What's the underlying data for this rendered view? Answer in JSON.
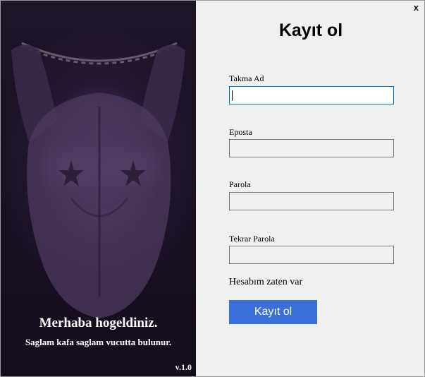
{
  "hero": {
    "greeting": "Merhaba hogeldiniz.",
    "slogan": "Saglam kafa saglam vucutta bulunur.",
    "version": "v.1.0"
  },
  "window": {
    "close_label": "x"
  },
  "form": {
    "title": "Kayıt ol",
    "fields": [
      {
        "label": "Takma Ad",
        "value": "",
        "focused": true
      },
      {
        "label": "Eposta",
        "value": ""
      },
      {
        "label": "Parola",
        "value": ""
      },
      {
        "label": "Tekrar Parola",
        "value": ""
      }
    ],
    "login_link": "Hesabım zaten var",
    "submit_label": "Kayıt ol"
  },
  "colors": {
    "panel_dark": "#1a1124",
    "accent_button": "#3a6fd8",
    "focus_border": "#0078d7"
  }
}
